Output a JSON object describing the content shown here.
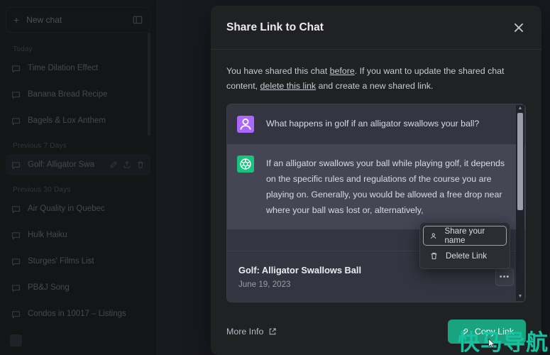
{
  "sidebar": {
    "new_chat_label": "New chat",
    "groups": [
      {
        "label": "Today",
        "items": [
          {
            "title": "Time Dilation Effect"
          },
          {
            "title": "Banana Bread Recipe"
          },
          {
            "title": "Bagels & Lox Anthem"
          }
        ]
      },
      {
        "label": "Previous 7 Days",
        "items": [
          {
            "title": "Golf: Alligator Swa"
          }
        ]
      },
      {
        "label": "Previous 30 Days",
        "items": [
          {
            "title": "Air Quality in Quebec"
          },
          {
            "title": "Hulk Haiku"
          },
          {
            "title": "Sturges' Films List"
          },
          {
            "title": "PB&J Song"
          },
          {
            "title": "Condos in 10017 – Listings"
          }
        ]
      }
    ],
    "account_label": ""
  },
  "modal": {
    "title": "Share Link to Chat",
    "close_label": "×",
    "description": {
      "part1": "You have shared this chat ",
      "link1": "before",
      "part2": ". If you want to update the shared chat content, ",
      "link2": "delete this link",
      "part3": " and create a new shared link."
    },
    "preview": {
      "messages": [
        {
          "role": "user",
          "text": "What happens in golf if an alligator swallows your ball?"
        },
        {
          "role": "assistant",
          "text": "If an alligator swallows your ball while playing golf, it depends on the specific rules and regulations of the course you are playing on. Generally, you would be allowed a free drop near where your ball was lost or, alternatively,"
        }
      ],
      "chat_title": "Golf: Alligator Swallows Ball",
      "chat_date": "June 19, 2023",
      "more_button_label": "•••"
    },
    "context_menu": {
      "items": [
        {
          "label": "Share your name",
          "icon": "user-icon",
          "focused": true
        },
        {
          "label": "Delete Link",
          "icon": "trash-icon",
          "focused": false
        }
      ]
    },
    "footer": {
      "more_info_label": "More Info",
      "copy_button_label": "Copy Link"
    }
  },
  "watermark": {
    "text": "快马导航网"
  },
  "colors": {
    "accent_green": "#19a37f",
    "avatar_user": "#ab68ff",
    "avatar_bot": "#19c37d",
    "modal_bg": "#202123",
    "bubble_user": "#343541",
    "bubble_bot": "#444654",
    "watermark": "#17c2a0"
  }
}
